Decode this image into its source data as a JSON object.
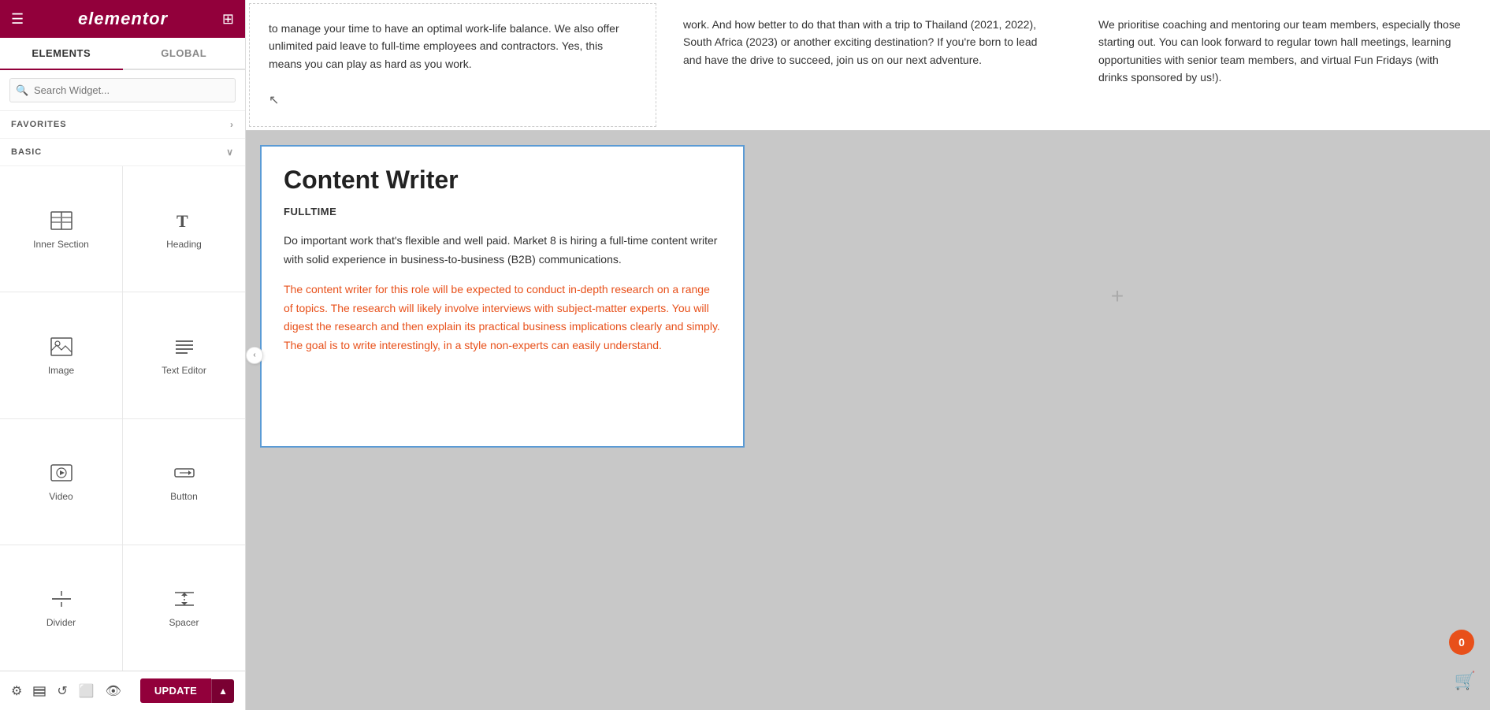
{
  "sidebar": {
    "logo": "elementor",
    "tabs": [
      {
        "label": "ELEMENTS",
        "active": true
      },
      {
        "label": "GLOBAL",
        "active": false
      }
    ],
    "search_placeholder": "Search Widget...",
    "favorites_label": "FAVORITES",
    "favorites_chevron": "›",
    "basic_label": "BASIC",
    "basic_chevron": "∨",
    "widgets": [
      {
        "id": "inner-section",
        "label": "Inner Section"
      },
      {
        "id": "heading",
        "label": "Heading"
      },
      {
        "id": "image",
        "label": "Image"
      },
      {
        "id": "text-editor",
        "label": "Text Editor"
      },
      {
        "id": "video",
        "label": "Video"
      },
      {
        "id": "button",
        "label": "Button"
      },
      {
        "id": "divider",
        "label": "Divider"
      },
      {
        "id": "spacer",
        "label": "Spacer"
      }
    ],
    "update_label": "UPDATE",
    "notification_count": "0"
  },
  "canvas": {
    "top_text_col1": "to manage your time to have an optimal work-life balance. We also offer unlimited paid leave to full-time employees and contractors. Yes, this means you can play as hard as you work.",
    "top_text_col2": "work. And how better to do that than with a trip to Thailand (2021, 2022), South Africa (2023) or another exciting destination? If you're born to lead and have the drive to succeed, join us on our next adventure.",
    "top_text_col3": "We prioritise coaching and mentoring our team members, especially those starting out. You can look forward to regular town hall meetings, learning opportunities with senior team members, and virtual Fun Fridays (with drinks sponsored by us!).",
    "job": {
      "title": "Content Writer",
      "type": "FULLTIME",
      "desc1": "Do important work that's flexible and well paid. Market 8 is hiring a full-time content writer with solid experience in business-to-business (B2B) communications.",
      "desc2": "The content writer for this role will be expected to conduct in-depth research on a range of topics. The research will likely involve interviews with subject-matter experts. You will digest the research and then explain its practical business implications clearly and simply. The goal is to write interestingly, in a style non-experts can easily understand."
    },
    "add_icon": "+"
  }
}
